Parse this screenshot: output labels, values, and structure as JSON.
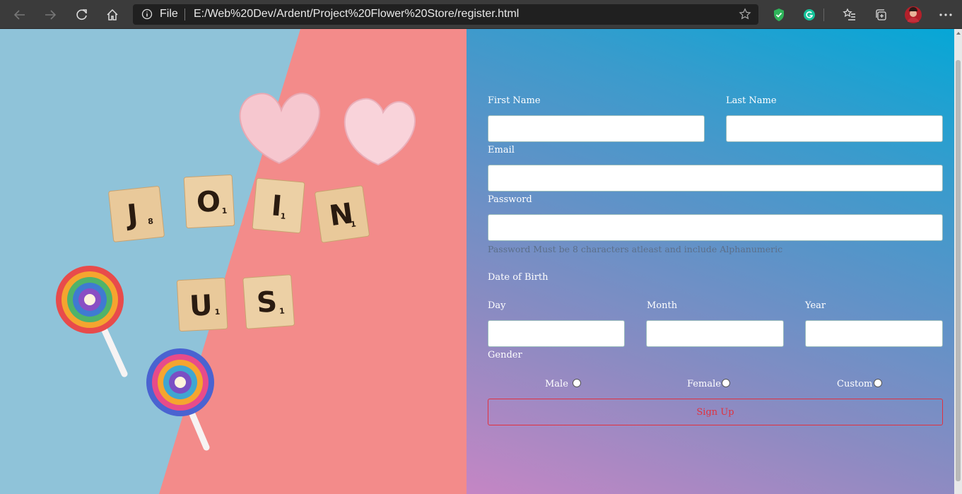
{
  "browser": {
    "file_label": "File",
    "url": "E:/Web%20Dev/Ardent/Project%20Flower%20Store/register.html"
  },
  "hero": {
    "tiles": [
      {
        "letter": "J",
        "score": "8"
      },
      {
        "letter": "O",
        "score": "1"
      },
      {
        "letter": "I",
        "score": "1"
      },
      {
        "letter": "N",
        "score": "1"
      },
      {
        "letter": "U",
        "score": "1"
      },
      {
        "letter": "S",
        "score": "1"
      }
    ],
    "colors": {
      "left_bg": "#8fc3d9",
      "right_bg": "#f38b8a",
      "tile": "#e9c99a",
      "heart": "#f6c7cf"
    }
  },
  "form": {
    "first_name_label": "First Name",
    "last_name_label": "Last Name",
    "email_label": "Email",
    "password_label": "Password",
    "password_hint": "Password Must be 8 characters atleast and include Alphanumeric",
    "dob_label": "Date of Birth",
    "day_label": "Day",
    "month_label": "Month",
    "year_label": "Year",
    "gender_label": "Gender",
    "gender_options": [
      "Male",
      "Female",
      "Custom"
    ],
    "signup_label": "Sign Up",
    "accent_color": "#e0313f"
  }
}
